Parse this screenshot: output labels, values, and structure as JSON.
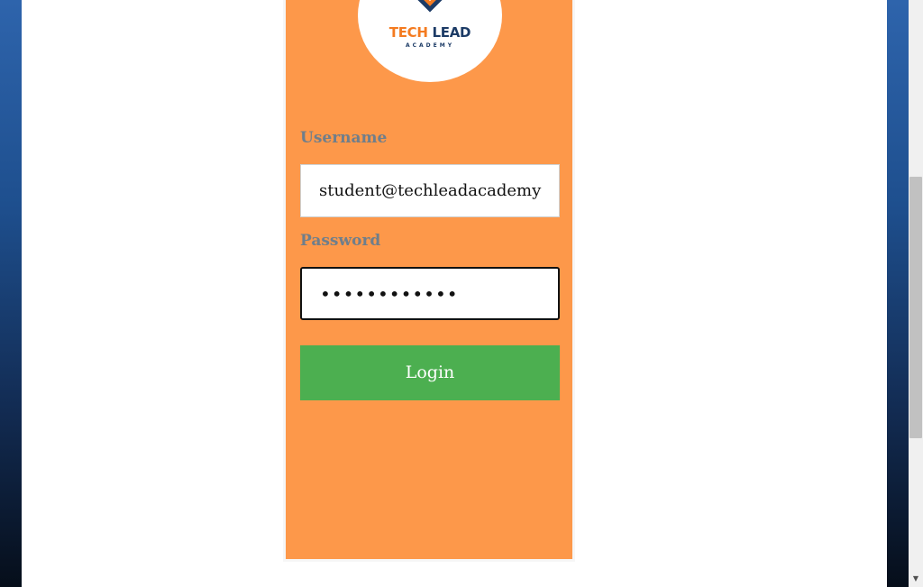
{
  "logo": {
    "word_tech": "TECH",
    "word_lead": "LEAD",
    "subtitle": "ACADEMY",
    "icon": "diamond-logo-icon",
    "colors": {
      "orange": "#f47b20",
      "navy": "#1c3b66"
    }
  },
  "form": {
    "username_label": "Username",
    "username_value": "student@techleadacademy",
    "password_label": "Password",
    "password_value": "••••••••••••",
    "login_label": "Login"
  },
  "colors": {
    "card": "#fd984a",
    "button": "#4caf50",
    "label": "#6f7e8b"
  },
  "scrollbar": {
    "down_icon": "chevron-down-icon"
  }
}
